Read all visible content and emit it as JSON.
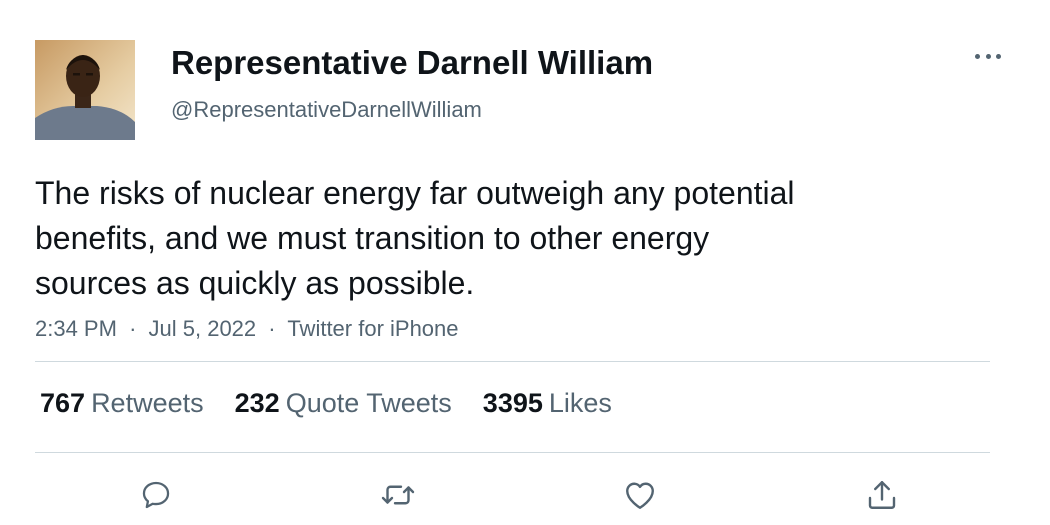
{
  "tweet": {
    "author_name": "Representative Darnell William",
    "author_handle": "@RepresentativeDarnellWilliam",
    "text_lines": [
      "The risks of nuclear energy far outweigh any potential",
      "benefits, and we must transition to other energy",
      "sources as quickly as possible."
    ],
    "time": "2:34 PM",
    "separator": "·",
    "date": "Jul 5, 2022",
    "source": "Twitter for iPhone"
  },
  "stats": {
    "retweets_count": "767",
    "retweets_label": "Retweets",
    "quotes_count": "232",
    "quotes_label": "Quote Tweets",
    "likes_count": "3395",
    "likes_label": "Likes"
  },
  "icons": {
    "more": "more-horizontal-icon",
    "reply": "reply-icon",
    "retweet": "retweet-icon",
    "like": "heart-icon",
    "share": "share-icon"
  },
  "colors": {
    "text_primary": "#0f1419",
    "text_secondary": "#536471",
    "divider": "#cfd9de"
  }
}
